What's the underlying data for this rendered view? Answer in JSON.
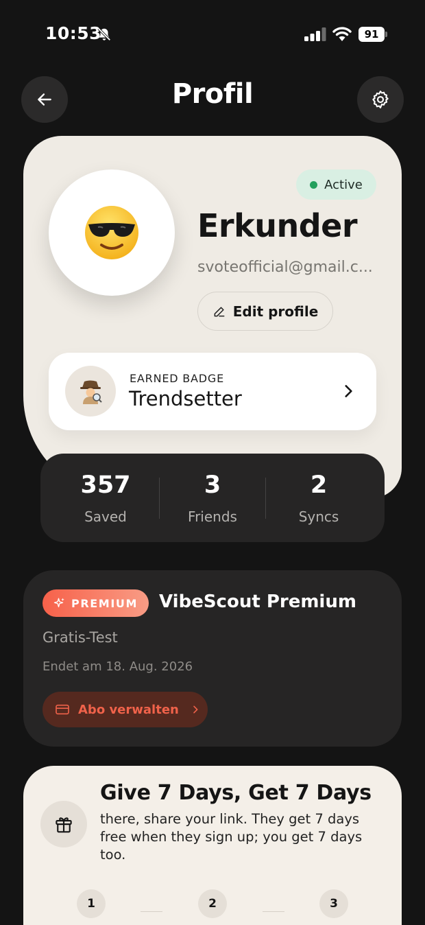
{
  "status_bar": {
    "time": "10:53",
    "battery": "91"
  },
  "header": {
    "title": "Profil"
  },
  "profile": {
    "status": "Active",
    "avatar_emoji": "😎",
    "name": "Erkunder",
    "email": "svoteofficial@gmail.c...",
    "edit_label": "Edit profile"
  },
  "badge": {
    "caption": "EARNED BADGE",
    "name": "Trendsetter",
    "emoji": "🕵️‍♀️"
  },
  "stats": [
    {
      "value": "357",
      "label": "Saved"
    },
    {
      "value": "3",
      "label": "Friends"
    },
    {
      "value": "2",
      "label": "Syncs"
    }
  ],
  "premium": {
    "badge": "PREMIUM",
    "title": "VibeScout Premium",
    "plan": "Gratis-Test",
    "end_date": "Endet am 18. Aug. 2026",
    "manage_label": "Abo verwalten"
  },
  "referral": {
    "title": "Give 7 Days, Get 7 Days",
    "text": "there, share your link. They get 7 days free when they sign up; you get 7 days too.",
    "steps": [
      "1",
      "2",
      "3"
    ]
  },
  "colors": {
    "background": "#141414",
    "card_light": "#efebe4",
    "accent": "#f7614a",
    "active_green": "#23a05d"
  }
}
